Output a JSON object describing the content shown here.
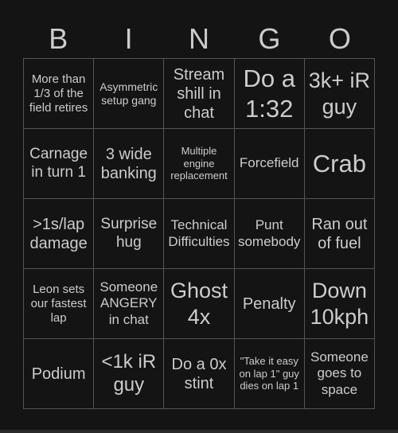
{
  "header": {
    "letters": [
      "B",
      "I",
      "N",
      "G",
      "O"
    ]
  },
  "cells": [
    "More than 1/3 of the field retires",
    "Asymmetric setup gang",
    "Stream shill in chat",
    "Do a 1:32",
    "3k+ iR guy",
    "Carnage in turn 1",
    "3 wide banking",
    "Multiple engine replacement",
    "Forcefield",
    "Crab",
    ">1s/lap damage",
    "Surprise hug",
    "Technical Difficulties",
    "Punt somebody",
    "Ran out of fuel",
    "Leon sets our fastest lap",
    "Someone ANGERY in chat",
    "Ghost 4x",
    "Penalty",
    "Down 10kph",
    "Podium",
    "<1k iR guy",
    "Do a 0x stint",
    "\"Take it easy on lap 1\" guy dies on lap 1",
    "Someone goes to space"
  ]
}
